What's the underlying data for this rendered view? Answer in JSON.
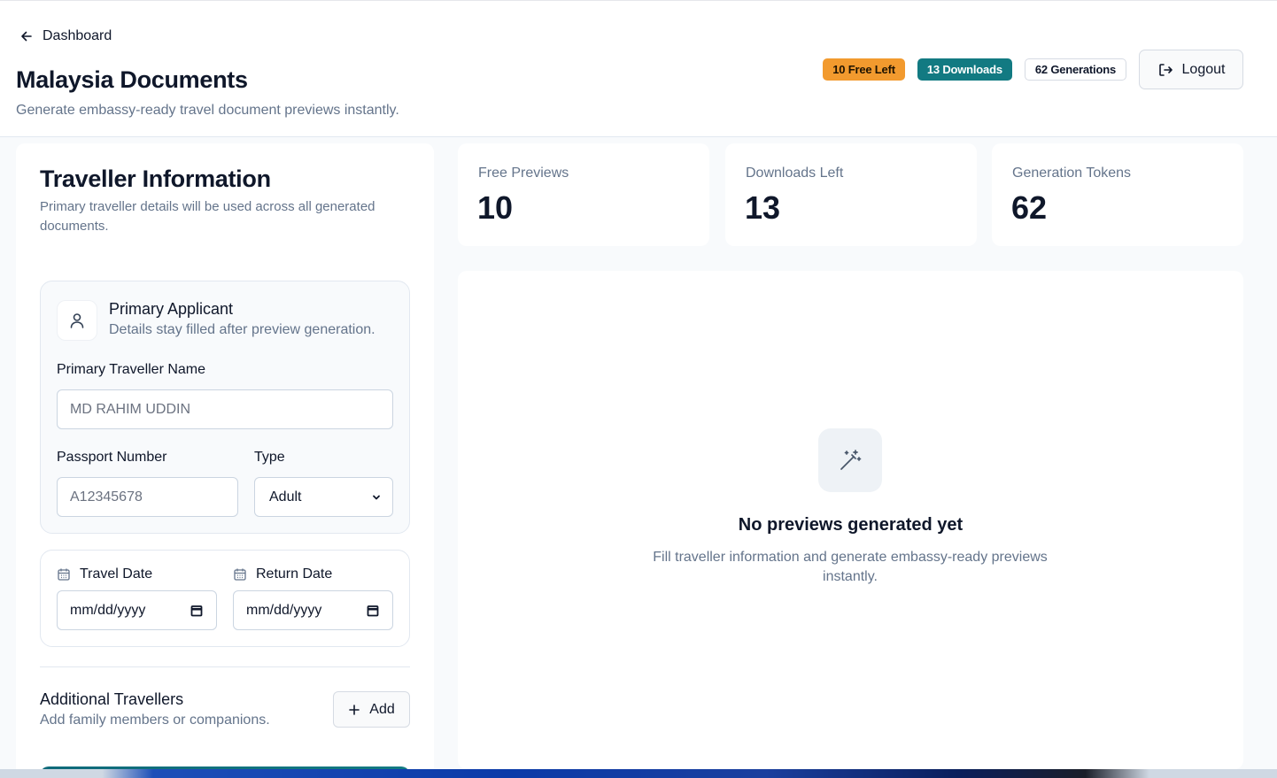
{
  "header": {
    "back_label": "Dashboard",
    "title": "Malaysia Documents",
    "subtitle": "Generate embassy-ready travel document previews instantly.",
    "badges": {
      "free": "10 Free Left",
      "downloads": "13 Downloads",
      "generations": "62 Generations"
    },
    "logout_label": "Logout"
  },
  "form": {
    "title": "Traveller Information",
    "description": "Primary traveller details will be used across all generated documents.",
    "applicant": {
      "title": "Primary Applicant",
      "description": "Details stay filled after preview generation.",
      "name_label": "Primary Traveller Name",
      "name_placeholder": "MD RAHIM UDDIN",
      "passport_label": "Passport Number",
      "passport_placeholder": "A12345678",
      "type_label": "Type",
      "type_value": "Adult"
    },
    "dates": {
      "travel_label": "Travel Date",
      "travel_value": "mm/dd/yyyy",
      "return_label": "Return Date",
      "return_value": "mm/dd/yyyy"
    },
    "additional": {
      "title": "Additional Travellers",
      "description": "Add family members or companions.",
      "add_label": "Add"
    }
  },
  "stats": [
    {
      "label": "Free Previews",
      "value": "10"
    },
    {
      "label": "Downloads Left",
      "value": "13"
    },
    {
      "label": "Generation Tokens",
      "value": "62"
    }
  ],
  "preview": {
    "empty_title": "No previews generated yet",
    "empty_description": "Fill traveller information and generate embassy-ready previews instantly."
  },
  "colors": {
    "badge_free": "#f29a2e",
    "badge_downloads": "#127a82",
    "text_primary": "#0f172a",
    "text_muted": "#64748b"
  }
}
